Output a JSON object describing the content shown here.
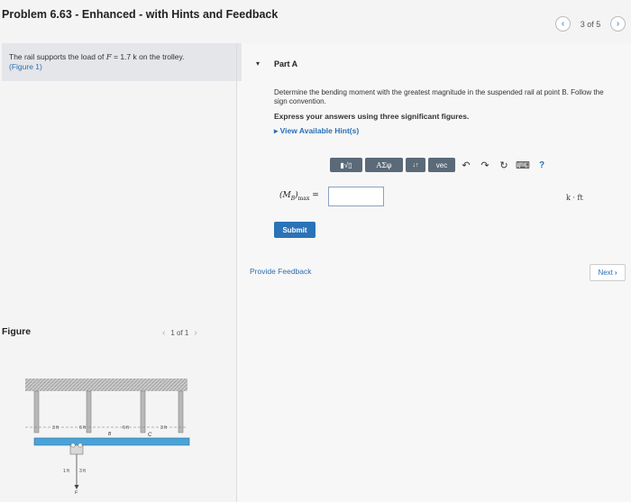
{
  "header": {
    "title": "Problem 6.63 - Enhanced - with Hints and Feedback",
    "pager_text": "3 of 5",
    "prev_arrow": "‹",
    "next_arrow": "›"
  },
  "problem": {
    "text_before": "The rail supports the load of ",
    "var": "F",
    "text_after": " = 1.7 k on the trolley.",
    "figure_link": "(Figure 1)"
  },
  "part": {
    "toggle": "▾",
    "title": "Part A",
    "question": "Determine the bending moment with the greatest magnitude in the suspended rail at point B. Follow the sign convention.",
    "instruction": "Express your answers using three significant figures.",
    "hint_link": "▸ View Available Hint(s)"
  },
  "toolbar": {
    "templates": "▮√▯",
    "greek": "ΑΣφ",
    "updown": "↓↑",
    "vec": "vec",
    "undo": "↶",
    "redo": "↷",
    "reset": "↻",
    "keyboard": "⌨",
    "help": "?"
  },
  "answer": {
    "label": "(M",
    "label_sub": "B",
    "label_close": ")",
    "label_max": "max",
    "equals": " =",
    "value": "",
    "units": "k · ft"
  },
  "buttons": {
    "submit": "Submit",
    "provide_feedback": "Provide Feedback",
    "next": "Next",
    "next_arrow": "›"
  },
  "figure": {
    "label": "Figure",
    "pager": "1 of 1",
    "prev": "‹",
    "next": "›",
    "dims": [
      "3 ft",
      "6 ft",
      "6 ft",
      "3 ft"
    ],
    "bottom_dims": [
      "1 ft",
      "3 ft"
    ],
    "point_b": "B",
    "point_c": "C",
    "load": "F"
  }
}
